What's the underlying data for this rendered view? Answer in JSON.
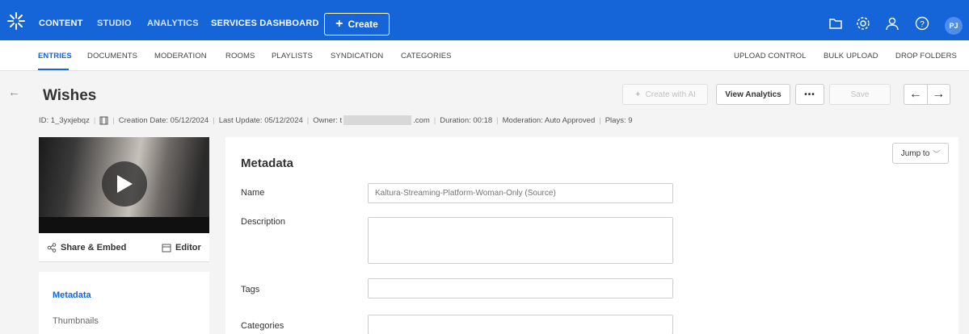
{
  "topbar": {
    "nav": [
      "CONTENT",
      "STUDIO",
      "ANALYTICS",
      "SERVICES DASHBOARD"
    ],
    "create_label": "Create",
    "icons": [
      "folder-icon",
      "settings-icon",
      "user-icon",
      "help-icon"
    ],
    "avatar_initials": "PJ",
    "brand_color": "#1565d8"
  },
  "subnav": {
    "left": [
      "ENTRIES",
      "DOCUMENTS",
      "MODERATION",
      "ROOMS",
      "PLAYLISTS",
      "SYNDICATION",
      "CATEGORIES"
    ],
    "right": [
      "UPLOAD CONTROL",
      "BULK UPLOAD",
      "DROP FOLDERS"
    ]
  },
  "entry": {
    "title": "Wishes",
    "id": "ID: 1_3yxjebqz",
    "creation_date": "Creation Date: 05/12/2024",
    "last_update": "Last Update: 05/12/2024",
    "owner_prefix": "Owner: t",
    "owner_suffix": ".com",
    "duration": "Duration: 00:18",
    "moderation": "Moderation: Auto Approved",
    "plays": "Plays: 9"
  },
  "actions": {
    "create_ai": "Create with AI",
    "view_analytics": "View Analytics",
    "more": "•••",
    "save": "Save"
  },
  "media": {
    "share_embed": "Share & Embed",
    "editor": "Editor"
  },
  "sidemenu": [
    "Metadata",
    "Thumbnails"
  ],
  "metadata": {
    "section_title": "Metadata",
    "jump_to": "Jump to",
    "fields": {
      "name_label": "Name",
      "name_placeholder": "Kaltura-Streaming-Platform-Woman-Only (Source)",
      "description_label": "Description",
      "tags_label": "Tags",
      "categories_label": "Categories"
    }
  }
}
